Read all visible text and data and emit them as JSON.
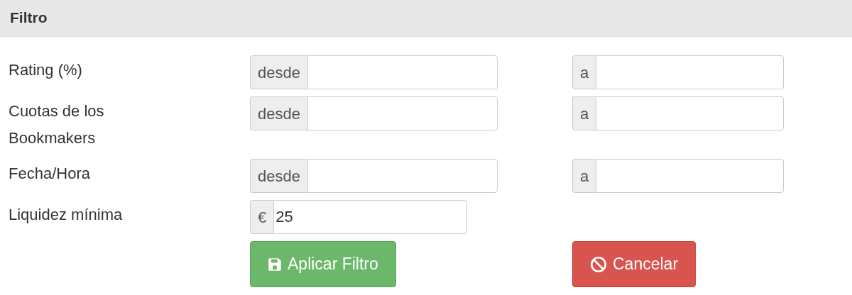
{
  "header": {
    "title": "Filtro"
  },
  "rows": [
    {
      "kind": "range",
      "label": "Rating (%)",
      "from": {
        "addon": "desde"
      },
      "to": {
        "addon": "a"
      }
    },
    {
      "kind": "range",
      "label": "Cuotas de los Bookmakers",
      "from": {
        "addon": "desde"
      },
      "to": {
        "addon": "a"
      }
    },
    {
      "kind": "range",
      "label": "Fecha/Hora",
      "from": {
        "addon": "desde"
      },
      "to": {
        "addon": "a"
      }
    },
    {
      "kind": "single",
      "label": "Liquidez mínima",
      "addon": "€",
      "value": "25"
    }
  ],
  "buttons": [
    {
      "kind": "apply",
      "label": "Aplicar Filtro"
    },
    {
      "kind": "cancel",
      "label": "Cancelar"
    }
  ]
}
